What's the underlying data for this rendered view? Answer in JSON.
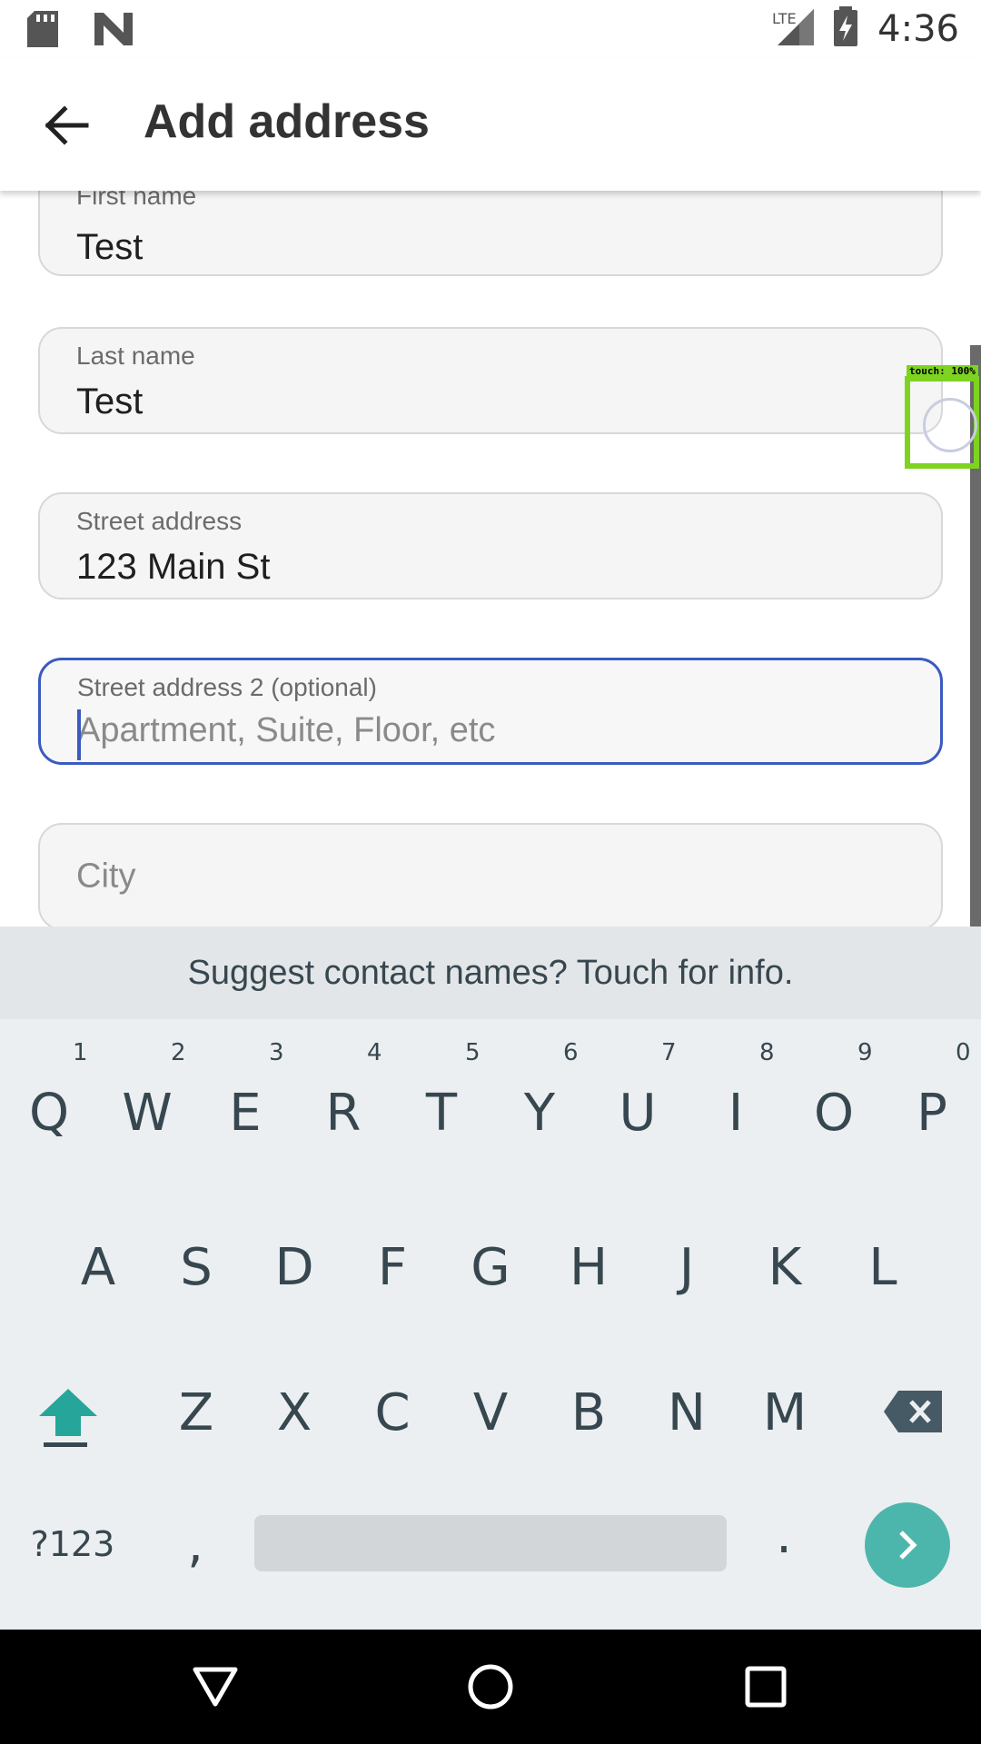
{
  "status": {
    "time": "4:36",
    "network": "LTE"
  },
  "app_bar": {
    "title": "Add address"
  },
  "form": {
    "first_name": {
      "label": "First name",
      "value": "Test"
    },
    "last_name": {
      "label": "Last name",
      "value": "Test"
    },
    "street": {
      "label": "Street address",
      "value": "123 Main St"
    },
    "street2": {
      "label": "Street address 2 (optional)",
      "placeholder": "Apartment, Suite, Floor, etc"
    },
    "city": {
      "placeholder": "City"
    }
  },
  "touch_overlay": {
    "label": "touch: 100%"
  },
  "keyboard": {
    "suggestion": "Suggest contact names? Touch for info.",
    "row1": [
      "Q",
      "W",
      "E",
      "R",
      "T",
      "Y",
      "U",
      "I",
      "O",
      "P"
    ],
    "row1_hints": [
      "1",
      "2",
      "3",
      "4",
      "5",
      "6",
      "7",
      "8",
      "9",
      "0"
    ],
    "row2": [
      "A",
      "S",
      "D",
      "F",
      "G",
      "H",
      "J",
      "K",
      "L"
    ],
    "row3": [
      "Z",
      "X",
      "C",
      "V",
      "B",
      "N",
      "M"
    ],
    "symbols_label": "?123",
    "comma": ",",
    "period": "."
  },
  "colors": {
    "accent": "#3a5bbf",
    "keyboard_enter": "#4db6ac",
    "touch_box": "#7ed321"
  },
  "icons": {
    "sd_card": "sd-card-icon",
    "n_logo": "n-logo-icon",
    "signal": "signal-icon",
    "battery": "battery-charging-icon",
    "back": "back-arrow-icon",
    "shift": "shift-icon",
    "backspace": "backspace-icon",
    "enter": "chevron-right-icon",
    "nav_back": "triangle-back-icon",
    "nav_home": "circle-home-icon",
    "nav_recent": "square-recent-icon"
  }
}
